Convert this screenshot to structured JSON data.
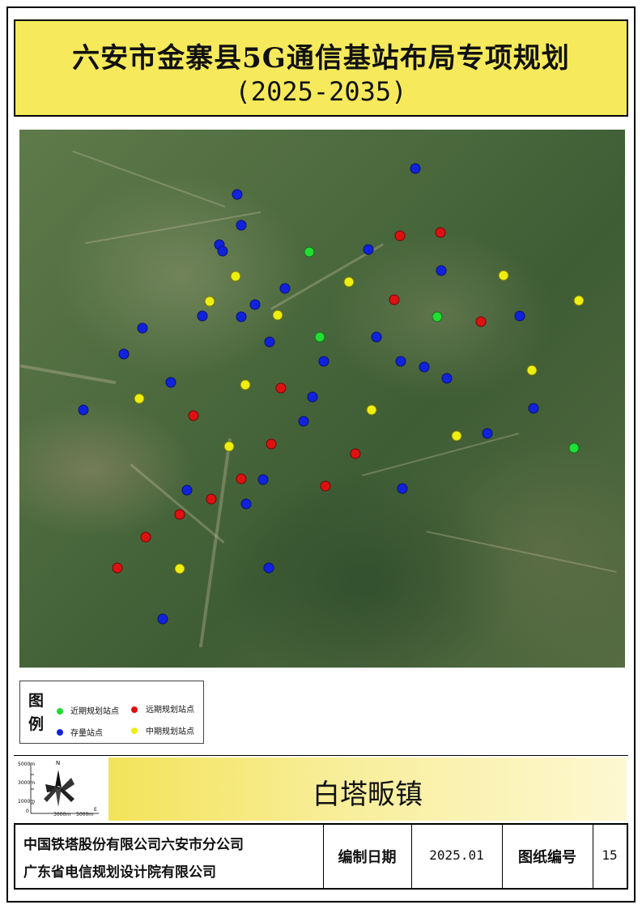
{
  "title": {
    "main": "六安市金寨县5G通信基站布局专项规划",
    "years": "(2025-2035)"
  },
  "legend": {
    "heading": "图例",
    "items": [
      {
        "label": "近期规划站点",
        "color": "#22dd33"
      },
      {
        "label": "远期规划站点",
        "color": "#dd1111"
      },
      {
        "label": "存量站点",
        "color": "#1122dd"
      },
      {
        "label": "中期规划站点",
        "color": "#eeee11"
      }
    ]
  },
  "compass": {
    "north": "N",
    "y_ticks": [
      "5000m",
      "3000m",
      "1000m",
      "0"
    ],
    "x_ticks": [
      "3000m",
      "5000m"
    ],
    "east": "E"
  },
  "town": "白塔畈镇",
  "footer": {
    "company_1": "中国铁塔股份有限公司六安市分公司",
    "company_2": "广东省电信规划设计院有限公司",
    "date_label": "编制日期",
    "date_value": "2025.01",
    "sheet_label": "图纸编号",
    "sheet_value": "15"
  },
  "colors": {
    "near": "#22dd33",
    "far": "#dd1111",
    "existing": "#1122dd",
    "mid": "#eeee11",
    "title_bg": "#f6ea5c"
  }
}
